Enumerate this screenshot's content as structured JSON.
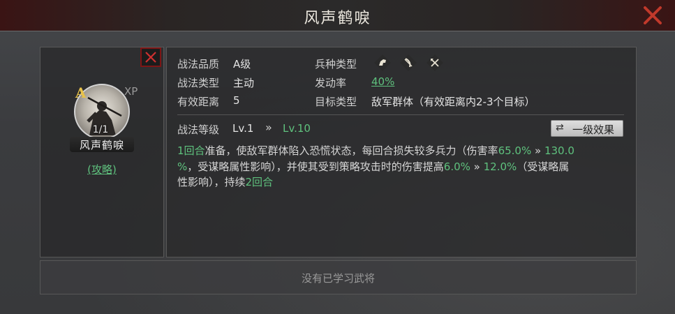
{
  "window": {
    "title": "风声鹤唳"
  },
  "skill_card": {
    "grade": "A",
    "xp_label": "XP",
    "count": "1/1",
    "name": "风声鹤唳",
    "strategy_link": "(攻略)"
  },
  "info": {
    "quality_label": "战法品质",
    "quality_value": "A级",
    "type_label": "战法类型",
    "type_value": "主动",
    "range_label": "有效距离",
    "range_value": "5",
    "troop_label": "兵种类型",
    "troop_icons": [
      "cavalry-icon",
      "archer-icon",
      "shield-icon"
    ],
    "rate_label": "发动率",
    "rate_value": "40%",
    "target_label": "目标类型",
    "target_value": "敌军群体（有效距离内2-3个目标）"
  },
  "level": {
    "label": "战法等级",
    "from": "Lv.1",
    "arrow": "»",
    "to": "Lv.10",
    "effect_button": "一级效果"
  },
  "description": {
    "l1_a": "1回合",
    "l1_b": "准备，使敌军群体陷入恐慌状态，每回合损失较多兵力（伤害率",
    "l1_c": "65.0%",
    "l1_d": " » ",
    "l1_e": "130.0",
    "l2_a": "%",
    "l2_b": "，受谋略属性影响），并使其受到策略攻击时的伤害提高",
    "l2_c": "6.0%",
    "l2_d": " » ",
    "l2_e": "12.0%",
    "l2_f": "（受谋略属",
    "l3_a": "性影响），持续",
    "l3_b": "2回合"
  },
  "footer": {
    "text": "没有已学习武将"
  },
  "colors": {
    "accent_green": "#5fc27e",
    "close_red": "#c0392b",
    "grade_gold": "#e8c24a"
  }
}
